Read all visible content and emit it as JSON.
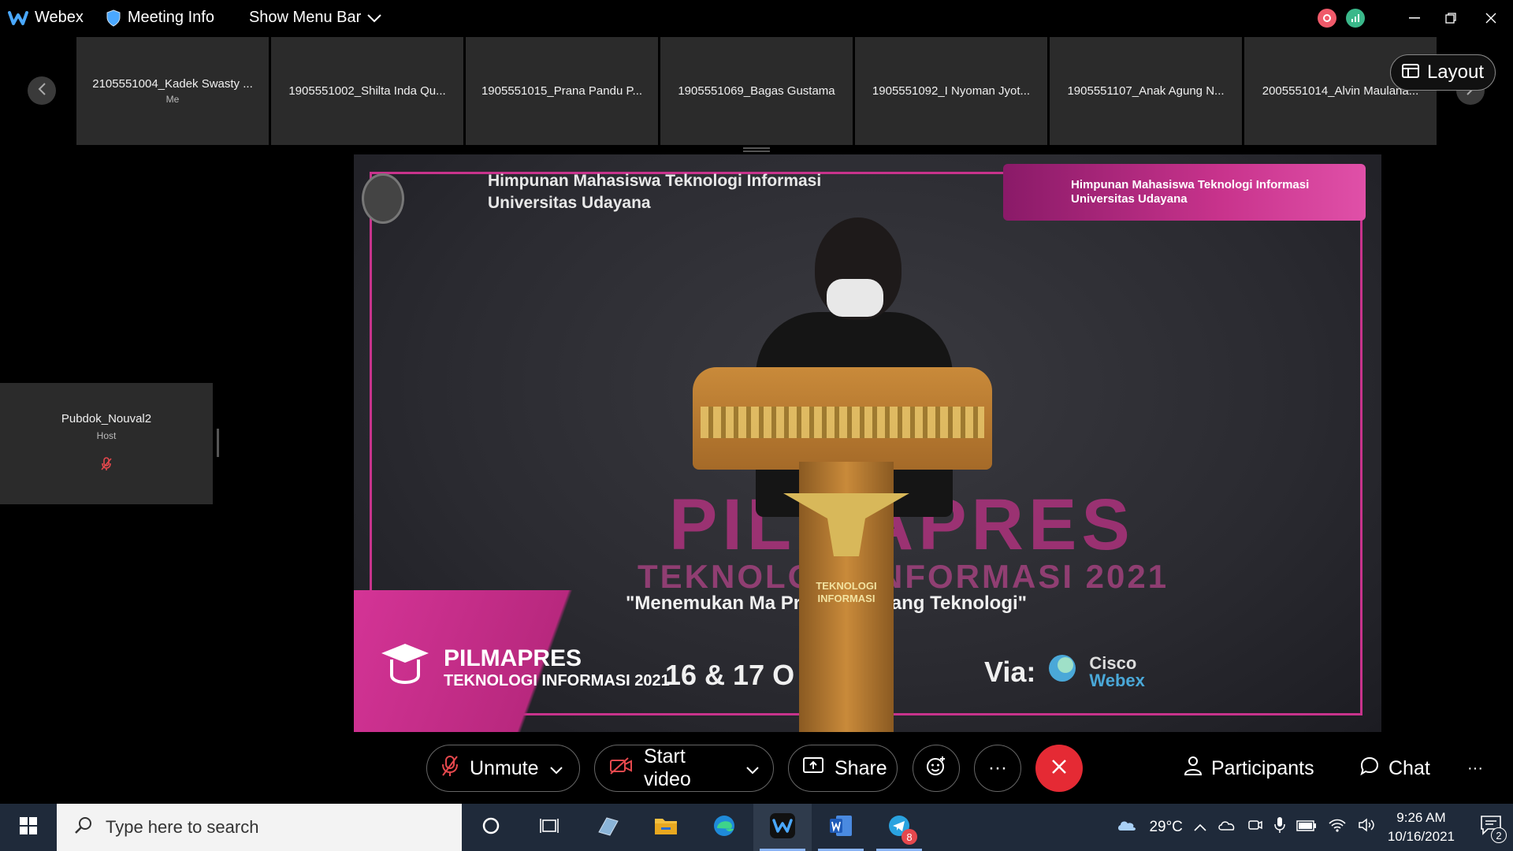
{
  "titlebar": {
    "app_name": "Webex",
    "meeting_info": "Meeting Info",
    "show_menu_bar": "Show Menu Bar"
  },
  "strip": {
    "participants": [
      {
        "name": "2105551004_Kadek Swasty ...",
        "sub": "Me"
      },
      {
        "name": "1905551002_Shilta Inda Qu...",
        "sub": ""
      },
      {
        "name": "1905551015_Prana Pandu P...",
        "sub": ""
      },
      {
        "name": "1905551069_Bagas Gustama",
        "sub": ""
      },
      {
        "name": "1905551092_I Nyoman Jyot...",
        "sub": ""
      },
      {
        "name": "1905551107_Anak Agung N...",
        "sub": ""
      },
      {
        "name": "2005551014_Alvin Maulana...",
        "sub": ""
      }
    ],
    "layout_label": "Layout"
  },
  "side_tile": {
    "name": "Pubdok_Nouval2",
    "role": "Host"
  },
  "stage": {
    "org_line1": "Himpunan Mahasiswa Teknologi Informasi",
    "org_line2": "Universitas Udayana",
    "banner_line1": "Himpunan Mahasiswa Teknologi Informasi",
    "banner_line2": "Universitas Udayana",
    "big_title": "PILMAPRES",
    "sub_title": "TEKNOLOGI INFORMASI 2021",
    "tagline": "\"Menemukan Ma          Prima di Bidang Teknologi\"",
    "date_line": "16 & 17 O          21",
    "via_label": "Via:",
    "cisco": "Cisco",
    "webex": "Webex",
    "corner_title": "PILMAPRES",
    "corner_sub": "TEKNOLOGI INFORMASI 2021",
    "podium_caption": "TEKNOLOGI INFORMASI"
  },
  "controls": {
    "unmute": "Unmute",
    "start_video": "Start video",
    "share": "Share",
    "more": "···",
    "participants": "Participants",
    "chat": "Chat",
    "overflow": "···"
  },
  "taskbar": {
    "search_placeholder": "Type here to search",
    "temperature": "29°C",
    "time": "9:26 AM",
    "date": "10/16/2021",
    "telegram_badge": "8",
    "notification_count": "2"
  },
  "colors": {
    "accent_pink": "#c8338c",
    "end_red": "#e52a34",
    "tile_bg": "#2b2b2b"
  }
}
